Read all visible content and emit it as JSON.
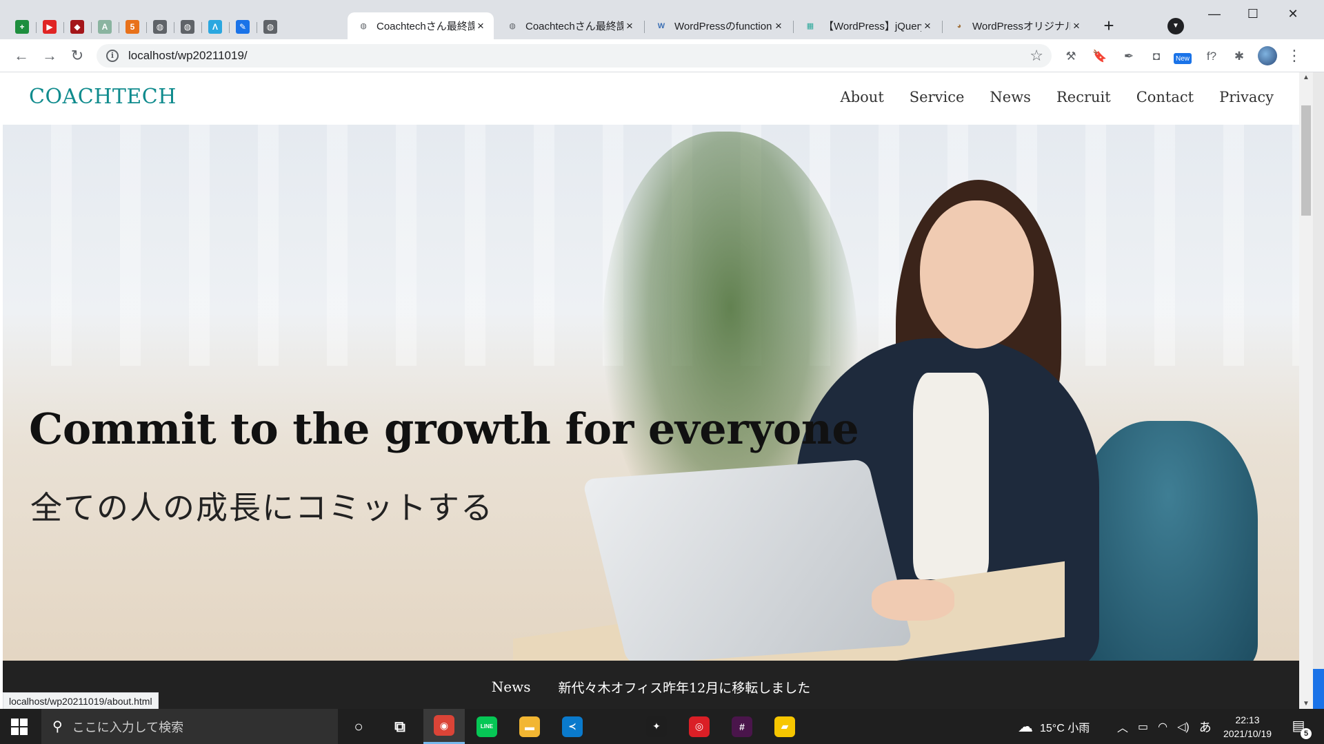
{
  "browser": {
    "pinned_tabs": [
      {
        "name": "sheets-icon",
        "glyph": "+",
        "color": "#1e8e3e"
      },
      {
        "name": "youtube-icon",
        "glyph": "▶",
        "color": "#e02424"
      },
      {
        "name": "extension-tab-icon",
        "glyph": "◆",
        "color": "#a4161a"
      },
      {
        "name": "font-tab-icon",
        "glyph": "A",
        "color": "#8ab4a0"
      },
      {
        "name": "html-tab-icon",
        "glyph": "5",
        "color": "#e8711a"
      },
      {
        "name": "globe-icon",
        "glyph": "◍",
        "color": "#5f6368"
      },
      {
        "name": "globe-icon",
        "glyph": "◍",
        "color": "#5f6368"
      },
      {
        "name": "vector-tab-icon",
        "glyph": "Λ",
        "color": "#2aa7e0"
      },
      {
        "name": "edit-tab-icon",
        "glyph": "✎",
        "color": "#1a73e8"
      },
      {
        "name": "globe-icon",
        "glyph": "◍",
        "color": "#5f6368"
      }
    ],
    "tabs": [
      {
        "title": "Coachtechさん最終課",
        "active": true,
        "icon": "◍",
        "icon_color": "#5f6368"
      },
      {
        "title": "Coachtechさん最終課",
        "active": false,
        "icon": "◍",
        "icon_color": "#5f6368"
      },
      {
        "title": "WordPressのfunction",
        "active": false,
        "icon": "W",
        "icon_color": "#3c6fb4"
      },
      {
        "title": "【WordPress】jQueryの",
        "active": false,
        "icon": "▦",
        "icon_color": "#2ba89a"
      },
      {
        "title": "WordPressオリジナルテ",
        "active": false,
        "icon": "◕",
        "icon_color": "#a0703a"
      }
    ],
    "close_glyph": "×",
    "new_tab_glyph": "+",
    "window_controls": {
      "minimize": "—",
      "maximize": "☐",
      "close": "✕"
    },
    "url": "localhost/wp20211019/",
    "extensions": [
      {
        "name": "tools-extension-icon",
        "glyph": "⚒"
      },
      {
        "name": "bookmark-extension-icon",
        "glyph": "🔖"
      },
      {
        "name": "picker-extension-icon",
        "glyph": "✒"
      },
      {
        "name": "stamp-extension-icon",
        "glyph": "◘"
      },
      {
        "name": "new-extension-icon",
        "glyph": "New"
      },
      {
        "name": "formula-extension-icon",
        "glyph": "f?"
      },
      {
        "name": "puzzle-extension-icon",
        "glyph": "✱"
      }
    ],
    "status_url": "localhost/wp20211019/about.html"
  },
  "site": {
    "logo": "COACHTECH",
    "nav": [
      "About",
      "Service",
      "News",
      "Recruit",
      "Contact",
      "Privacy"
    ],
    "hero_title": "Commit to the growth for everyone",
    "hero_subtitle": "全ての人の成長にコミットする",
    "news_label": "News",
    "news_text": "新代々木オフィス昨年12月に移転しました"
  },
  "taskbar": {
    "search_placeholder": "ここに入力して検索",
    "apps": [
      {
        "name": "cortana-icon",
        "glyph": "○",
        "color": "transparent"
      },
      {
        "name": "task-view-icon",
        "glyph": "⧉",
        "color": "transparent"
      },
      {
        "name": "chrome-icon",
        "glyph": "◉",
        "color": "#db4437",
        "active": true
      },
      {
        "name": "line-icon",
        "glyph": "LINE",
        "color": "#06c755"
      },
      {
        "name": "file-explorer-icon",
        "glyph": "▬",
        "color": "#f2b632"
      },
      {
        "name": "vscode-icon",
        "glyph": "≺",
        "color": "#0a7acc"
      },
      {
        "name": "figma-icon",
        "glyph": "✦",
        "color": "#1e1e1e"
      },
      {
        "name": "creative-cloud-icon",
        "glyph": "◎",
        "color": "#da1f26"
      },
      {
        "name": "slack-icon",
        "glyph": "#",
        "color": "#4a154b"
      },
      {
        "name": "sticky-notes-icon",
        "glyph": "▰",
        "color": "#f7c600"
      }
    ],
    "weather": "15°C 小雨",
    "ime": "あ",
    "time": "22:13",
    "date": "2021/10/19",
    "notification_count": "5"
  }
}
